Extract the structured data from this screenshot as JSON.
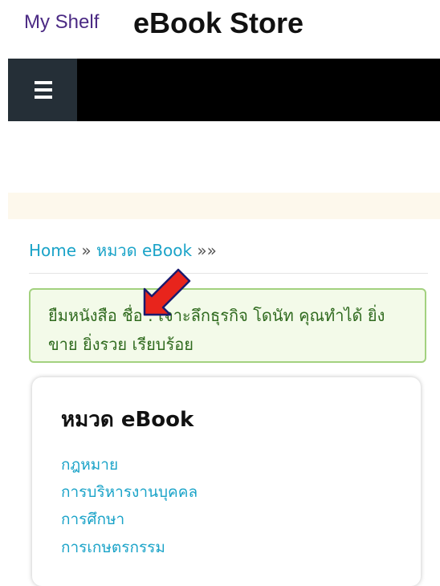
{
  "header": {
    "shelf_link": "My Shelf",
    "store_title": "eBook Store"
  },
  "nav": {
    "menu_icon": "hamburger-menu-icon"
  },
  "breadcrumb": {
    "home": "Home",
    "sep1": "»",
    "category": "หมวด eBook",
    "sep2": "»",
    "sep3": "»"
  },
  "alert": {
    "message": "ยืมหนังสือ ชื่อ : เจาะลึกธุรกิจ โดนัท คุณทำได้ ยิ่งขาย ยิ่งรวย เรียบร้อย"
  },
  "annotation": {
    "arrow_icon": "red-arrow-icon",
    "color": "#e8241c"
  },
  "category_card": {
    "title": "หมวด eBook",
    "items": [
      "กฎหมาย",
      "การบริหารงานบุคคล",
      "การศึกษา",
      "การเกษตรกรรม"
    ]
  },
  "colors": {
    "link": "#1aa3c8",
    "shelf": "#4b2a84",
    "alert_bg": "#f3fae9",
    "alert_border": "#a3d17f",
    "alert_text": "#2f6a1e",
    "menu_button": "#252f37"
  }
}
